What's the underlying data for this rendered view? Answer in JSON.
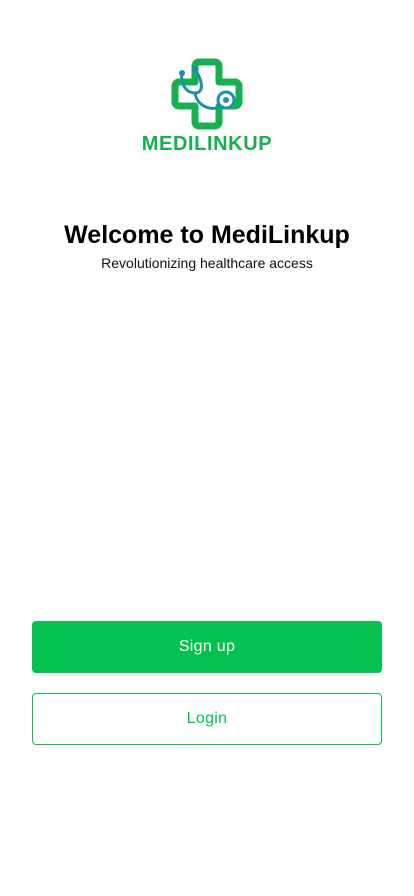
{
  "brand": {
    "name": "MEDILINKUP",
    "primary_color": "#05c150",
    "secondary_color": "#1a8fb0"
  },
  "welcome": {
    "title": "Welcome to MediLinkup",
    "subtitle": "Revolutionizing healthcare access"
  },
  "actions": {
    "signup_label": "Sign up",
    "login_label": "Login"
  }
}
